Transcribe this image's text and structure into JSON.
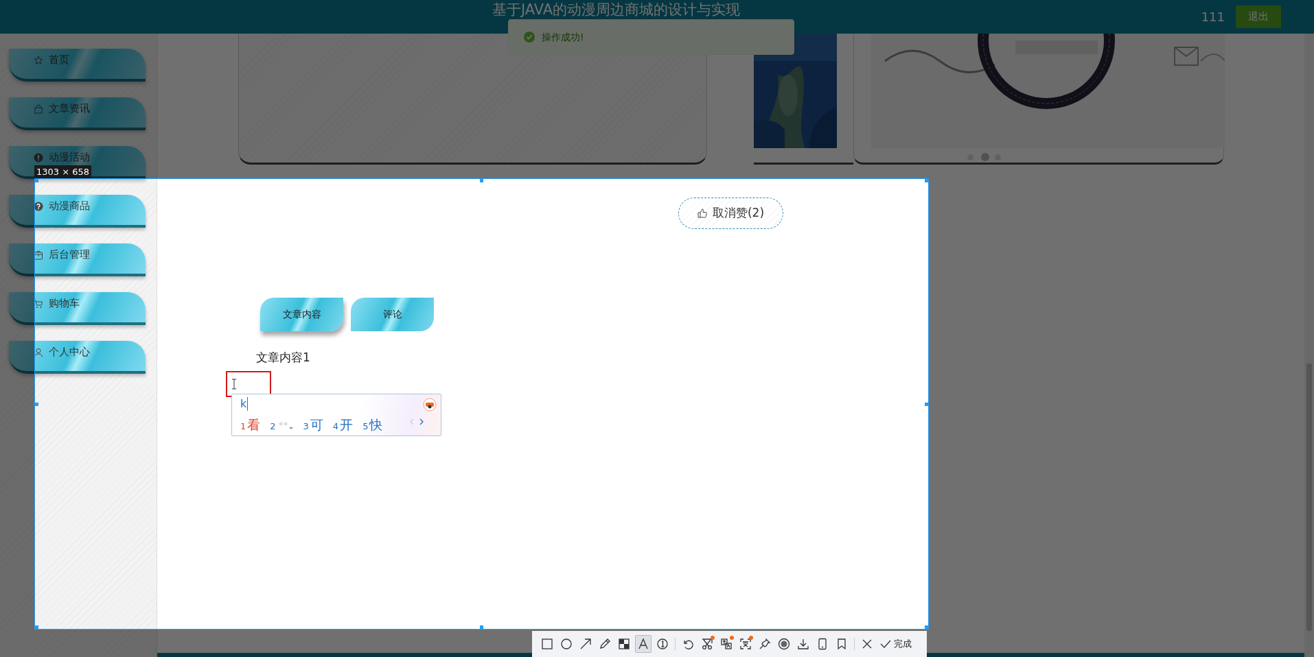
{
  "header": {
    "title": "基于JAVA的动漫周边商城的设计与实现",
    "username": "111",
    "logout_button": "退出"
  },
  "toast": {
    "message": "操作成功!"
  },
  "sidebar": {
    "items": [
      {
        "label": "首页",
        "kind": "star"
      },
      {
        "label": "文章资讯",
        "kind": "bag"
      },
      {
        "label": "动漫活动",
        "kind": "info"
      },
      {
        "label": "动漫商品",
        "kind": "question"
      },
      {
        "label": "后台管理",
        "kind": "box"
      },
      {
        "label": "购物车",
        "kind": "cart"
      },
      {
        "label": "个人中心",
        "kind": "person"
      }
    ]
  },
  "carousel": {
    "dots": [
      {
        "selected": false
      },
      {
        "selected": true
      },
      {
        "selected": false
      }
    ]
  },
  "like_button": {
    "label": "取消赞(2)"
  },
  "tabs": [
    {
      "label": "文章内容",
      "selected": true
    },
    {
      "label": "评论",
      "selected": false
    }
  ],
  "article": {
    "content": "文章内容1"
  },
  "ime": {
    "composition": "k",
    "candidates": [
      {
        "kind": "word",
        "number": "1",
        "text": "看",
        "selected": true
      },
      {
        "kind": "loading",
        "number": "2",
        "selected": false
      },
      {
        "kind": "word",
        "number": "3",
        "text": "可",
        "selected": false
      },
      {
        "kind": "word",
        "number": "4",
        "text": "开",
        "selected": false
      },
      {
        "kind": "word",
        "number": "5",
        "text": "快",
        "selected": false
      }
    ]
  },
  "screenshot": {
    "size_label": "1303 × 658",
    "tools": [
      {
        "kind": "rectangle",
        "selected": false,
        "badge": false
      },
      {
        "kind": "ellipse",
        "selected": false,
        "badge": false
      },
      {
        "kind": "arrow",
        "selected": false,
        "badge": false
      },
      {
        "kind": "pencil",
        "selected": false,
        "badge": false
      },
      {
        "kind": "mosaic",
        "selected": false,
        "badge": false
      },
      {
        "kind": "text",
        "selected": true,
        "badge": false
      },
      {
        "kind": "number",
        "selected": false,
        "badge": false
      },
      {
        "kind": "separator"
      },
      {
        "kind": "undo",
        "selected": false,
        "badge": false
      },
      {
        "kind": "scissors",
        "selected": false,
        "badge": true
      },
      {
        "kind": "translate",
        "selected": false,
        "badge": true
      },
      {
        "kind": "ocr",
        "selected": false,
        "badge": true
      },
      {
        "kind": "pin",
        "selected": false,
        "badge": false
      },
      {
        "kind": "record",
        "selected": false,
        "badge": false
      },
      {
        "kind": "download",
        "selected": false,
        "badge": false
      },
      {
        "kind": "phone",
        "selected": false,
        "badge": false
      },
      {
        "kind": "bookmark",
        "selected": false,
        "badge": false
      },
      {
        "kind": "separator"
      },
      {
        "kind": "close",
        "selected": false,
        "badge": false
      }
    ],
    "done_button": "完成"
  }
}
